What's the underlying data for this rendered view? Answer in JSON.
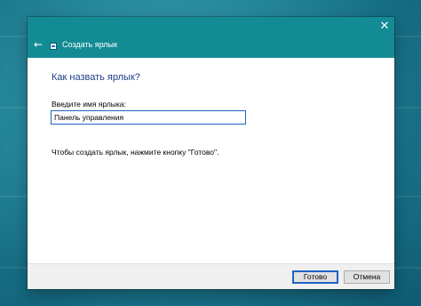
{
  "window": {
    "title": "Создать ярлык",
    "close_glyph": "✕",
    "back_glyph": "←"
  },
  "content": {
    "heading": "Как назвать ярлык?",
    "field_label": "Введите имя ярлыка:",
    "field_value": "Панель управления",
    "hint": "Чтобы создать ярлык, нажмите кнопку \"Готово\"."
  },
  "buttons": {
    "finish_label": "Готово",
    "cancel_label": "Отмена"
  },
  "icons": {
    "back": "back-arrow-icon",
    "close": "close-icon",
    "wizard": "shortcut-wizard-icon"
  },
  "colors": {
    "titlebar": "#138b95",
    "heading": "#1f3d8a",
    "focus_border": "#1e63c4"
  }
}
